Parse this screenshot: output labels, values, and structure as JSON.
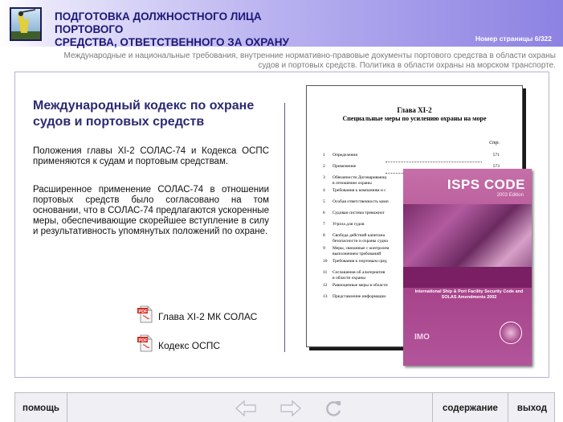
{
  "header": {
    "title_line1": "ПОДГОТОВКА ДОЛЖНОСТНОГО ЛИЦА ПОРТОВОГО",
    "title_line2": "СРЕДСТВА, ОТВЕТСТВЕННОГО ЗА ОХРАНУ",
    "page_number": "Номер страницы 6/322"
  },
  "breadcrumb": {
    "line1": "Международные и национальные требования, внутренние нормативно-правовые документы портового средства в области охраны",
    "line2": "судов и портовых средств. Политика в области охраны на морском транспорте."
  },
  "main": {
    "title": "Международный кодекс по охране судов и портовых средств",
    "paragraph1": "Положения главы XI-2 СОЛАС-74 и Кодекса ОСПС применяются к судам и портовым средствам.",
    "paragraph2": "Расширенное применение СОЛАС-74 в отношении портовых средств было согласовано на том основании, что в СОЛАС-74 предлагаются ускоренные меры, обеспечивающие скорейшее вступление в силу и результативность упомянутых положений по охране.",
    "links": [
      {
        "label": "Глава XI-2 МК СОЛАС"
      },
      {
        "label": "Кодекс ОСПС"
      }
    ]
  },
  "document": {
    "chapter": "Глава XI-2",
    "subtitle": "Специальные меры по усилению охраны на море",
    "page_label": "Стр.",
    "toc": [
      {
        "num": "1",
        "text": "Определения",
        "page": "571"
      },
      {
        "num": "2",
        "text": "Применение",
        "page": "573"
      },
      {
        "num": "3",
        "text": "Обязанности Договаривающ",
        "text2": "в отношении охраны",
        "page": ""
      },
      {
        "num": "4",
        "text": "Требования к компаниям и с",
        "page": ""
      },
      {
        "num": "5",
        "text": "Особая ответственность комп",
        "page": ""
      },
      {
        "num": "6",
        "text": "Судовая система тревожног",
        "page": ""
      },
      {
        "num": "7",
        "text": "Угроза для судов",
        "page": ""
      },
      {
        "num": "8",
        "text": "Свобода действий капитана",
        "text2": "безопасности и охраны судна",
        "page": ""
      },
      {
        "num": "9",
        "text": "Меры, связанные с контролем",
        "text2": "выполнением требований",
        "page": ""
      },
      {
        "num": "10",
        "text": "Требования к портовым сред",
        "page": ""
      },
      {
        "num": "11",
        "text": "Соглашения об альтернатив",
        "text2": "в области охраны",
        "page": ""
      },
      {
        "num": "12",
        "text": "Равноценные меры в области",
        "page": ""
      },
      {
        "num": "13",
        "text": "Представление информации",
        "page": ""
      }
    ]
  },
  "book": {
    "title": "ISPS CODE",
    "edition": "2003 Edition",
    "subtitle": "International Ship & Port Facility Security Code and SOLAS Amendments 2002",
    "publisher": "IMO"
  },
  "footer": {
    "help": "помощь",
    "contents": "содержание",
    "exit": "выход"
  },
  "colors": {
    "title_blue": "#1c1878",
    "book_magenta": "#a7438a",
    "pdf_red": "#d62b20"
  }
}
